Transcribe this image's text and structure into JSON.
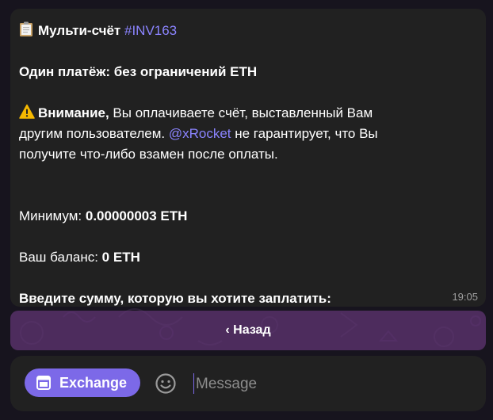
{
  "message": {
    "title_emoji": "clipboard-icon",
    "title": "Мульти-счёт",
    "tag": "#INV163",
    "payment_line": "Один платёж: без ограничений ETH",
    "warning_emoji": "warning-icon",
    "warning_bold": "Внимание,",
    "warning_text_1": " Вы оплачиваете счёт, выставленный Вам",
    "warning_text_2": "другим пользователем. ",
    "warning_link": "@xRocket",
    "warning_text_3": " не гарантирует, что Вы",
    "warning_text_4": "получите что-либо взамен после оплаты.",
    "minimum_label": "Минимум: ",
    "minimum_value": "0.00000003 ETH",
    "balance_label": "Ваш баланс: ",
    "balance_value": "0 ETH",
    "prompt": "Введите сумму, которую вы хотите заплатить:",
    "time": "19:05"
  },
  "keyboard": {
    "back_label": "‹ Назад"
  },
  "composer": {
    "exchange_label": "Exchange",
    "exchange_icon": "window-icon",
    "emoji_icon": "smiley-icon",
    "placeholder": "Message"
  },
  "colors": {
    "link": "#8b84ff",
    "accent": "#7c69e8",
    "bubble": "#212121",
    "keyboard_button": "#623676"
  }
}
